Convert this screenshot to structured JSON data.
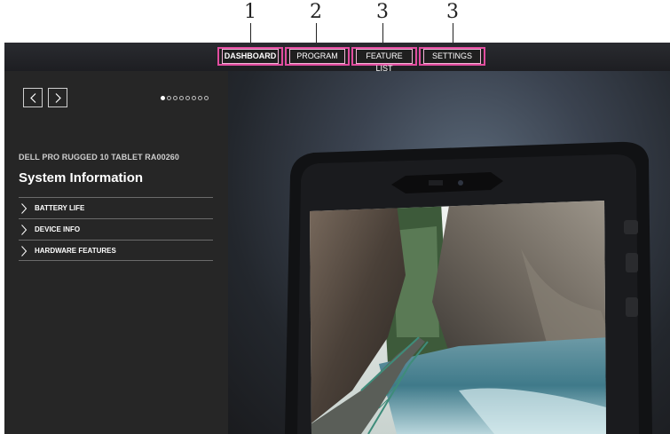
{
  "callouts": [
    "1",
    "2",
    "3",
    "3"
  ],
  "tabs": [
    {
      "label": "DASHBOARD",
      "active": true
    },
    {
      "label": "PROGRAM",
      "active": false
    },
    {
      "label": "FEATURE LIST",
      "active": false
    },
    {
      "label": "SETTINGS",
      "active": false
    }
  ],
  "sidebar": {
    "device_name": "DELL PRO RUGGED 10 TABLET RA00260",
    "title": "System Information",
    "menu": [
      {
        "label": "BATTERY LIFE",
        "icon": "chevron-right-icon"
      },
      {
        "label": "DEVICE INFO",
        "icon": "chevron-right-icon"
      },
      {
        "label": "HARDWARE FEATURES",
        "icon": "chevron-right-icon"
      }
    ],
    "pager": {
      "count": 8,
      "current": 1
    }
  },
  "colors": {
    "highlight_border": "#e24da0",
    "sidebar_bg": "#262626",
    "topbar_bg": "#1d1e22"
  }
}
